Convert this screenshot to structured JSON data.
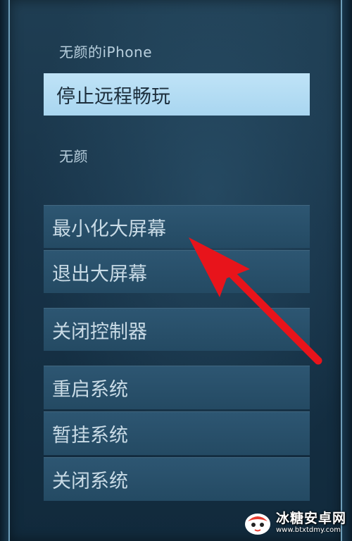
{
  "menu": {
    "device_label": "无颜的iPhone",
    "stop_remote_play": "停止远程畅玩",
    "user_label": "无颜",
    "minimize_big_screen": "最小化大屏幕",
    "exit_big_screen": "退出大屏幕",
    "close_controller": "关闭控制器",
    "restart_system": "重启系统",
    "suspend_system": "暂挂系统",
    "shutdown_system": "关闭系统"
  },
  "annotation": {
    "arrow_color": "#e8141b",
    "arrow_target": "minimize_big_screen"
  },
  "watermark": {
    "brand": "冰糖安卓网",
    "url": "www.btxtdmy.com"
  },
  "colors": {
    "active_item": "#bfe3f7",
    "menu_item": "#2d5672",
    "text": "#c9dbe6"
  }
}
